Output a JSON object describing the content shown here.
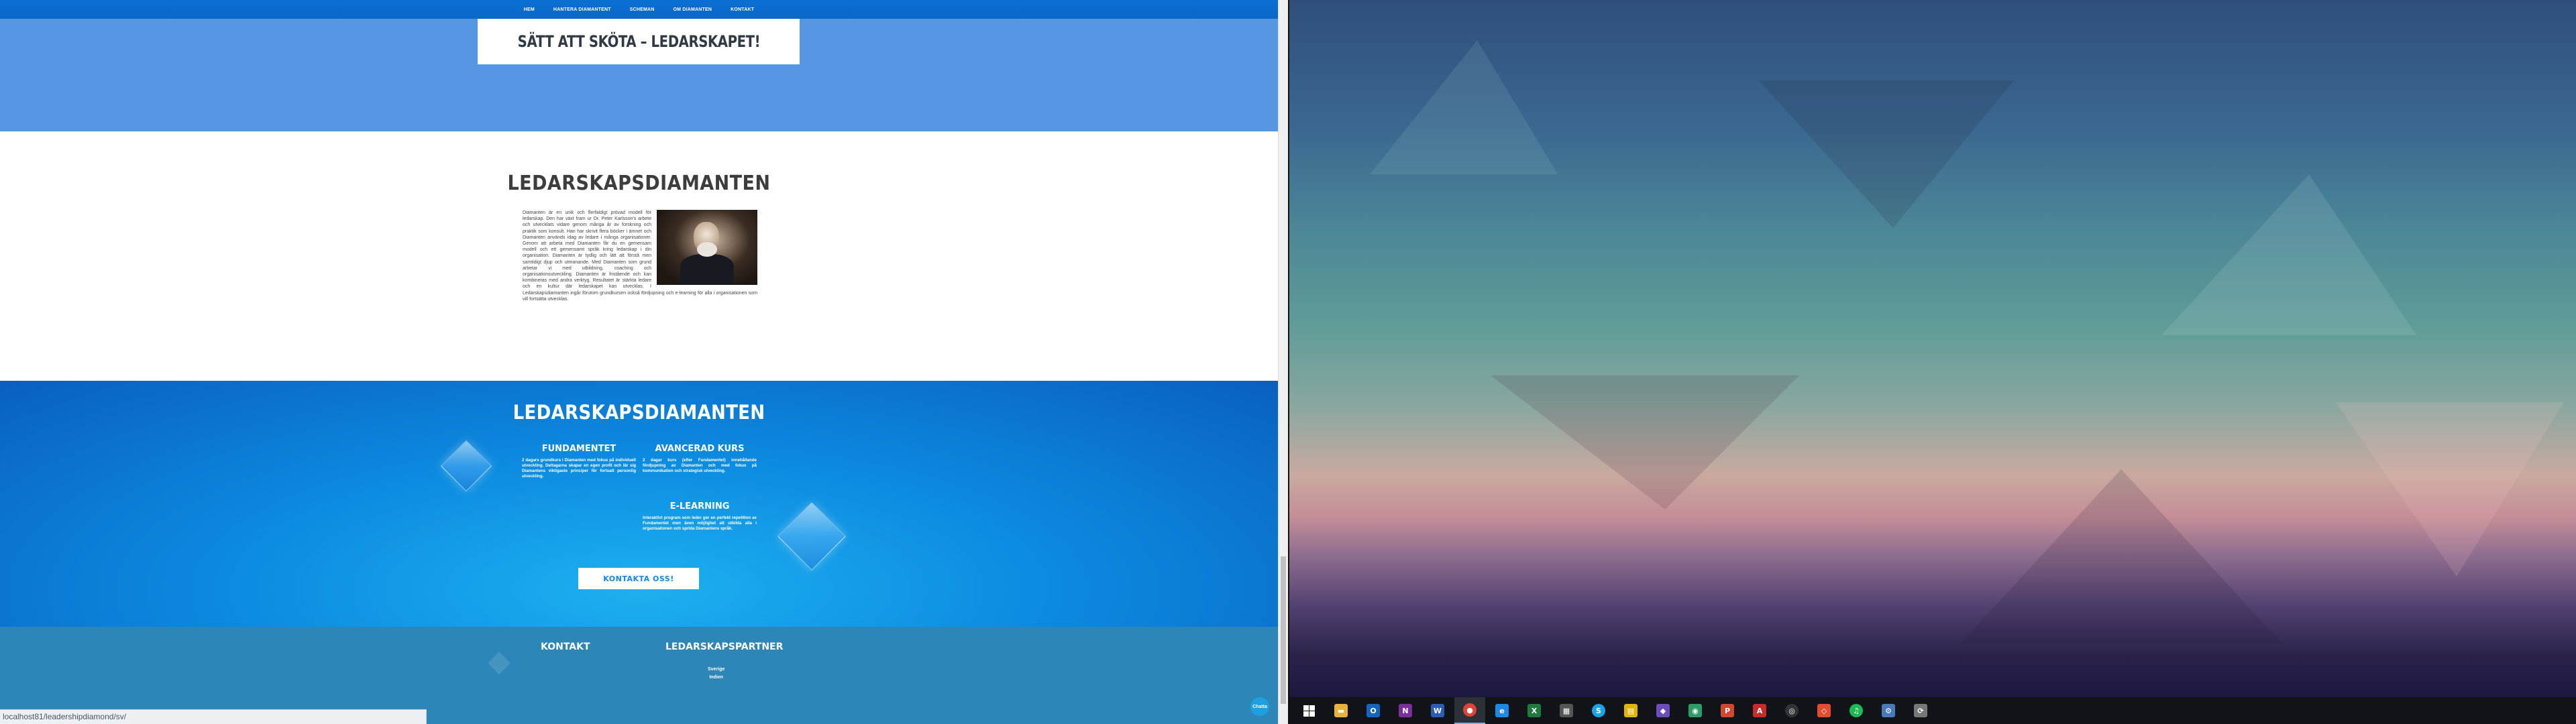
{
  "nav": {
    "items": [
      "HEM",
      "HANTERA DIAMANTENT",
      "SCHEMAN",
      "OM DIAMANTEN",
      "KONTAKT"
    ]
  },
  "hero": {
    "title": "SÄTT ATT SKÖTA – LEDARSKAPET!"
  },
  "about": {
    "title": "LEDARSKAPSDIAMANTEN",
    "text": "Diamanten är en unik och flerfaldigt prövad modell för ledarskap. Den har växt fram ur Dr. Peter Karlsson's arbete och utvecklats vidare genom många år av forskning och praktik som konsult. Han har skrivit flera böcker i ämnet och Diamanten används idag av ledare i många organisationer. Genom att arbeta med Diamanten får du en gemensam modell och ett gemensamt språk kring ledarskap i din organisation. Diamanten är tydlig och lätt att förstå men samtidigt djup och utmanande. Med Diamanten som grund arbetar vi med utbildning, coaching och organisationsutveckling. Diamanten är fristående och kan kombineras med andra verktyg. Resultatet är stärkta ledare och en kultur där ledarskapet kan utvecklas. I Ledarskapsdiamanten ingår förutom grundkursen också fördjupning och e-learning för alla i organisationen som vill fortsätta utvecklas."
  },
  "features": {
    "title": "LEDARSKAPSDIAMANTEN",
    "items": [
      {
        "title": "FUNDAMENTET",
        "text": "2 dagars grundkurs i Diamanten med fokus på individuell utveckling. Deltagarna skapar en egen profil och lär sig Diamantens viktigaste principer för fortsatt personlig utveckling."
      },
      {
        "title": "AVANCERAD KURS",
        "text": "2 dagar kurs (efter Fundamentet) innehållande fördjupning av Diamanten och med fokus på kommunikation och strategisk utveckling."
      },
      {
        "title": "E-LEARNING",
        "text": "Interaktivt program som leder ger en perfekt repetition av Fundamentet men även möjlighet att utbilda alla i organisationen och sprida Diamantens språk."
      }
    ],
    "cta": "KONTAKTA OSS!"
  },
  "footer": {
    "contact_title": "KONTAKT",
    "partners_title": "LEDARSKAPSPARTNER",
    "links": [
      "Sverige",
      "Indien"
    ]
  },
  "status": {
    "url": "localhost81/leadershipdiamond/sv/"
  },
  "chat": {
    "label": "Chatta"
  },
  "taskbar": {
    "items": [
      {
        "icon": "windows-start-icon",
        "label": "",
        "color": "transparent"
      },
      {
        "icon": "file-explorer-icon",
        "label": "▬",
        "color": "#e8b23a"
      },
      {
        "icon": "outlook-icon",
        "label": "O",
        "color": "#1565c0"
      },
      {
        "icon": "onenote-icon",
        "label": "N",
        "color": "#7b2e9c"
      },
      {
        "icon": "word-icon",
        "label": "W",
        "color": "#2b5db8"
      },
      {
        "icon": "chrome-icon",
        "label": "●",
        "color": "#db4437"
      },
      {
        "icon": "edge-icon",
        "label": "e",
        "color": "#1e88e5"
      },
      {
        "icon": "excel-icon",
        "label": "X",
        "color": "#1f7a3f"
      },
      {
        "icon": "calculator-icon",
        "label": "▦",
        "color": "#555555"
      },
      {
        "icon": "skype-icon",
        "label": "S",
        "color": "#1aa3e8"
      },
      {
        "icon": "sticky-notes-icon",
        "label": "▤",
        "color": "#e0b500"
      },
      {
        "icon": "visual-studio-icon",
        "label": "◆",
        "color": "#6a4dbb"
      },
      {
        "icon": "greenshot-icon",
        "label": "◉",
        "color": "#2e9c67"
      },
      {
        "icon": "powerpoint-icon",
        "label": "P",
        "color": "#d2472f"
      },
      {
        "icon": "acrobat-icon",
        "label": "A",
        "color": "#c72c2c"
      },
      {
        "icon": "github-icon",
        "label": "◎",
        "color": "#333333"
      },
      {
        "icon": "git-icon",
        "label": "◇",
        "color": "#e44c30"
      },
      {
        "icon": "spotify-icon",
        "label": "♫",
        "color": "#1db954"
      },
      {
        "icon": "tool-icon",
        "label": "⚙",
        "color": "#4a79b8"
      },
      {
        "icon": "remote-icon",
        "label": "⟳",
        "color": "#777777"
      }
    ],
    "active_index": 5
  }
}
